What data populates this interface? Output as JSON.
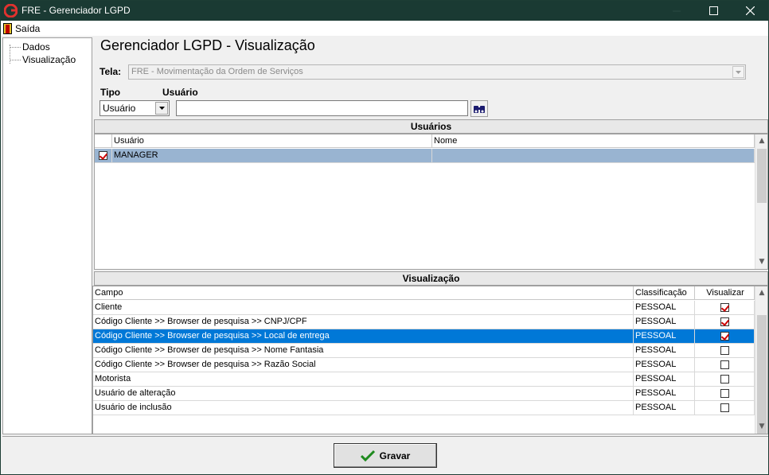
{
  "window": {
    "title": "FRE - Gerenciador LGPD"
  },
  "menu": {
    "exit_label": "Saída"
  },
  "tree": {
    "items": [
      "Dados",
      "Visualização"
    ]
  },
  "page": {
    "title": "Gerenciador LGPD - Visualização"
  },
  "form": {
    "tela_label": "Tela:",
    "tela_value": "FRE - Movimentação da Ordem de Serviços",
    "tipo_label": "Tipo",
    "tipo_value": "Usuário",
    "usuario_label": "Usuário",
    "usuario_value": ""
  },
  "usuarios": {
    "title": "Usuários",
    "columns": [
      "Usuário",
      "Nome"
    ],
    "rows": [
      {
        "checked": true,
        "usuario": "MANAGER",
        "nome": ""
      }
    ]
  },
  "visualizacao": {
    "title": "Visualização",
    "columns": [
      "Campo",
      "Classificação",
      "Visualizar"
    ],
    "rows": [
      {
        "campo": "Cliente",
        "classificacao": "PESSOAL",
        "visualizar": true
      },
      {
        "campo": "Código Cliente >> Browser de pesquisa >> CNPJ/CPF",
        "classificacao": "PESSOAL",
        "visualizar": true
      },
      {
        "campo": "Código Cliente >> Browser de pesquisa >> Local de entrega",
        "classificacao": "PESSOAL",
        "visualizar": true,
        "selected": true
      },
      {
        "campo": "Código Cliente >> Browser de pesquisa >> Nome Fantasia",
        "classificacao": "PESSOAL",
        "visualizar": false
      },
      {
        "campo": "Código Cliente >> Browser de pesquisa >> Razão Social",
        "classificacao": "PESSOAL",
        "visualizar": false
      },
      {
        "campo": "Motorista",
        "classificacao": "PESSOAL",
        "visualizar": false
      },
      {
        "campo": "Usuário de alteração",
        "classificacao": "PESSOAL",
        "visualizar": false
      },
      {
        "campo": "Usuário de inclusão",
        "classificacao": "PESSOAL",
        "visualizar": false
      }
    ]
  },
  "footer": {
    "save_label": "Gravar"
  },
  "colors": {
    "titlebar": "#1a3a33",
    "selection": "#0078d7",
    "user_selection": "#99b4d1",
    "check": "#c00000",
    "ok_icon": "#1e8a1e"
  },
  "icons": {
    "app": "app-logo-icon",
    "exit": "door-icon",
    "search": "binoculars-icon",
    "save": "checkmark-icon"
  }
}
